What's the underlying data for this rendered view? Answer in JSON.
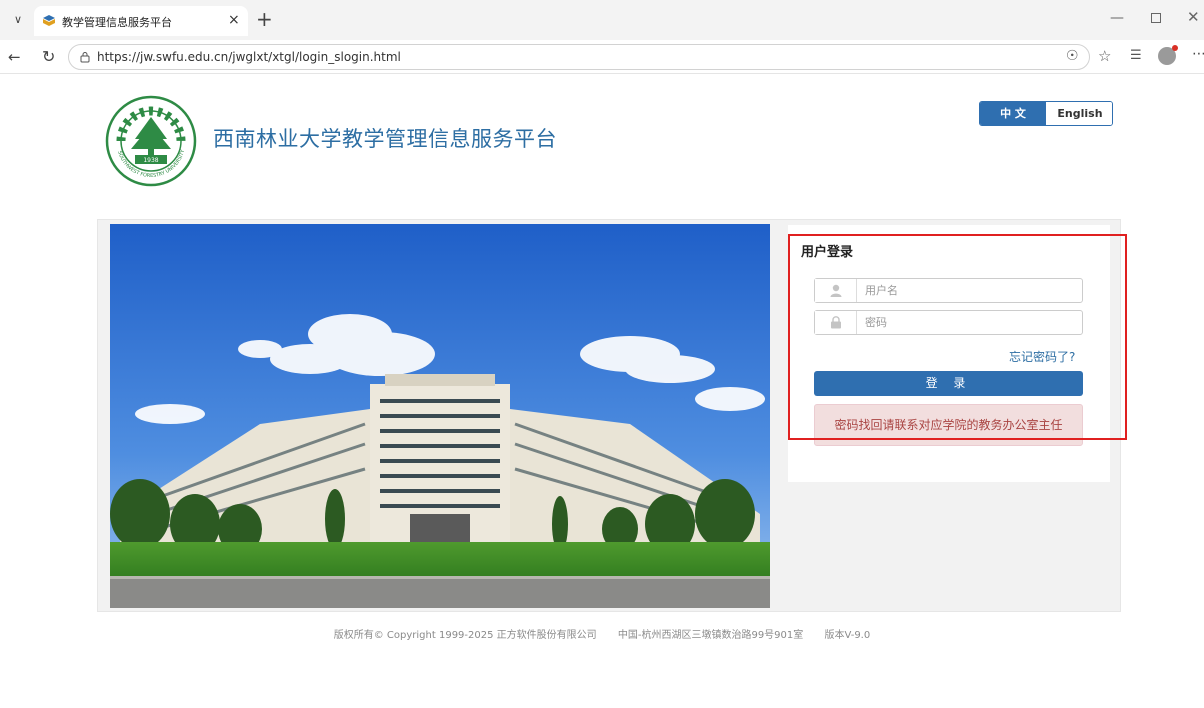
{
  "browser": {
    "tab_title": "教学管理信息服务平台",
    "tab_close": "×",
    "new_tab": "+",
    "url": "https://jw.swfu.edu.cn/jwglxt/xtgl/login_slogin.html",
    "icons": [
      "chevron-down-icon",
      "favicon-icon",
      "close-icon",
      "plus-icon",
      "minimize-icon",
      "maximize-icon",
      "back-icon",
      "reload-icon",
      "lock-icon",
      "tools-icon",
      "star-icon",
      "favorites-icon",
      "profile-icon",
      "more-icon"
    ]
  },
  "header": {
    "site_title": "西南林业大学教学管理信息服务平台",
    "logo_year": "1938",
    "logo_text_en": "SOUTHWEST FORESTRY UNIVERSITY"
  },
  "lang": {
    "zh": "中 文",
    "en": "English"
  },
  "login": {
    "title": "用户登录",
    "username_placeholder": "用户名",
    "password_placeholder": "密码",
    "forgot": "忘记密码了?",
    "submit": "登 录",
    "notice": "密码找回请联系对应学院的教务办公室主任"
  },
  "footer": {
    "copyright": "版权所有© Copyright 1999-2025 正方软件股份有限公司",
    "address": "中国-杭州西湖区三墩镇数治路99号901室",
    "version": "版本V-9.0"
  },
  "colors": {
    "brand_blue": "#2f6fb0",
    "title_blue": "#2d6ea3",
    "logo_green": "#2e8b45",
    "notice_bg": "#f2dede",
    "notice_text": "#a94442",
    "highlight_red": "#e02020"
  }
}
